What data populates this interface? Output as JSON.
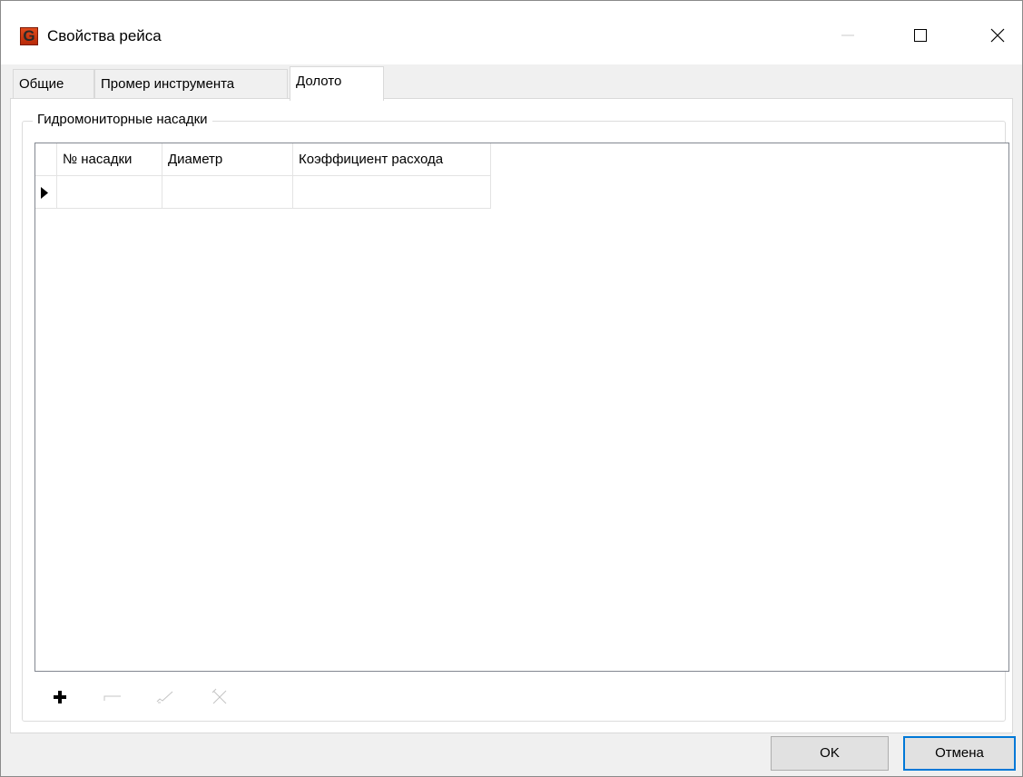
{
  "window": {
    "title": "Свойства рейса",
    "app_icon_letter": "G"
  },
  "tabs": [
    {
      "label": "Общие"
    },
    {
      "label": "Промер инструмента"
    },
    {
      "label": "Долото",
      "selected": true
    }
  ],
  "groupbox": {
    "legend": "Гидромониторные насадки"
  },
  "grid": {
    "columns": [
      "№ насадки",
      "Диаметр",
      "Коэффициент расхода"
    ],
    "rows": [
      {
        "cells": [
          "",
          "",
          ""
        ],
        "current": true
      }
    ]
  },
  "toolbar": {
    "items": [
      {
        "icon": "add-icon",
        "enabled": true
      },
      {
        "icon": "remove-icon",
        "enabled": false
      },
      {
        "icon": "edit-icon",
        "enabled": false
      },
      {
        "icon": "delete-icon",
        "enabled": false
      }
    ]
  },
  "buttons": {
    "ok_label": "OK",
    "cancel_label": "Отмена"
  },
  "colors": {
    "accent": "#0078d7",
    "app_icon": "#d8401a"
  }
}
